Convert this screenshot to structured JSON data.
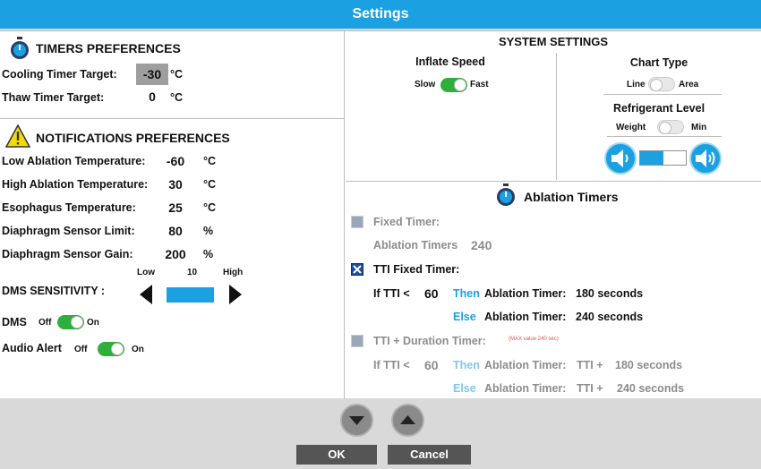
{
  "window": {
    "title": "Settings"
  },
  "timers": {
    "title": "TIMERS PREFERENCES",
    "cooling_label": "Cooling Timer Target:",
    "cooling_value": "-30",
    "cooling_unit": "°C",
    "thaw_label": "Thaw Timer Target:",
    "thaw_value": "0",
    "thaw_unit": "°C"
  },
  "notifications": {
    "title": "NOTIFICATIONS PREFERENCES",
    "rows": [
      {
        "label": "Low Ablation Temperature:",
        "value": "-60",
        "unit": "°C"
      },
      {
        "label": "High Ablation Temperature:",
        "value": "30",
        "unit": "°C"
      },
      {
        "label": "Esophagus Temperature:",
        "value": "25",
        "unit": "°C"
      },
      {
        "label": "Diaphragm Sensor Limit:",
        "value": "80",
        "unit": "%"
      },
      {
        "label": "Diaphragm Sensor Gain:",
        "value": "200",
        "unit": "%"
      }
    ],
    "sensitivity": {
      "low": "Low",
      "mid": "10",
      "high": "High",
      "label": "DMS SENSITIVITY :"
    },
    "dms": {
      "label": "DMS",
      "off": "Off",
      "on": "On"
    },
    "audio": {
      "label": "Audio Alert",
      "off": "Off",
      "on": "On"
    }
  },
  "system": {
    "title": "SYSTEM SETTINGS",
    "inflate": {
      "label": "Inflate Speed",
      "slow": "Slow",
      "fast": "Fast"
    },
    "chart": {
      "label": "Chart Type",
      "line": "Line",
      "area": "Area"
    },
    "refrigerant": {
      "label": "Refrigerant Level",
      "weight": "Weight",
      "min": "Min"
    }
  },
  "ablation": {
    "title": "Ablation Timers",
    "fixed": {
      "label": "Fixed Timer:",
      "sub_label": "Ablation Timers",
      "sub_value": "240"
    },
    "tti": {
      "label": "TTI Fixed Timer:",
      "if": "If TTI <",
      "threshold": "60",
      "then": "Then",
      "then_text": "Ablation Timer:",
      "then_value": "180 seconds",
      "else": "Else",
      "else_text": "Ablation Timer:",
      "else_value": "240 seconds"
    },
    "duration": {
      "label": "TTI + Duration Timer:",
      "note": "(MAX value 240 sec)",
      "if": "If TTI <",
      "threshold": "60",
      "then": "Then",
      "then_text": "Ablation Timer:",
      "then_tti": "TTI +",
      "then_value": "180 seconds",
      "else": "Else",
      "else_text": "Ablation Timer:",
      "else_tti": "TTI +",
      "else_value": "240 seconds"
    }
  },
  "footer": {
    "ok": "OK",
    "cancel": "Cancel"
  }
}
